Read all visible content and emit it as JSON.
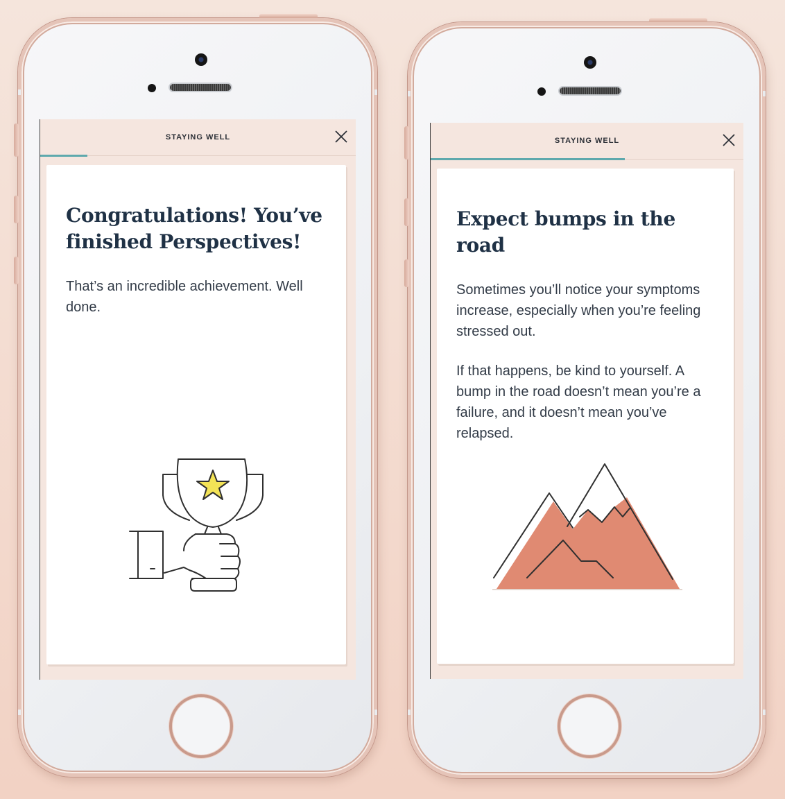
{
  "screens": [
    {
      "header_title": "STAYING WELL",
      "close_icon": "close-icon",
      "progress": 0.15,
      "card": {
        "title": "Congratulations! You’ve finished Perspectives!",
        "paragraphs": [
          "That’s an incredible achievement. Well done."
        ],
        "illustration": "trophy-in-hand-icon"
      }
    },
    {
      "header_title": "STAYING WELL",
      "close_icon": "close-icon",
      "progress": 0.62,
      "card": {
        "title": "Expect bumps in the road",
        "paragraphs": [
          "Sometimes you’ll notice your symptoms increase, especially when you’re feeling stressed out.",
          "If that happens, be kind to yourself. A bump in the road doesn’t mean you’re a failure, and it doesn’t mean you’ve relapsed."
        ],
        "illustration": "mountains-icon"
      }
    }
  ],
  "colors": {
    "background_top": "#f5e5dc",
    "background_bottom": "#f2d2c4",
    "screen_background": "#f5e6df",
    "progress_accent": "#5ea9ad",
    "title_text": "#1f3145",
    "star_fill": "#f3e356",
    "mountain_fill": "#e08a72"
  }
}
